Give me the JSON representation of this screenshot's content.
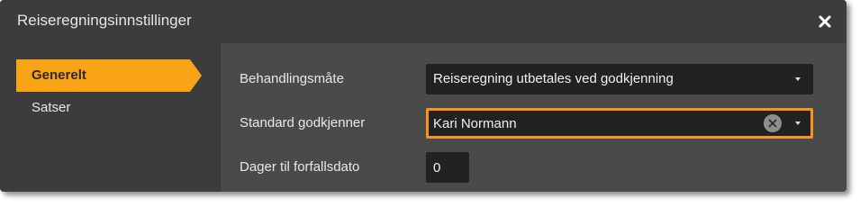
{
  "dialog": {
    "title": "Reiseregningsinnstillinger",
    "close_icon": "close-icon"
  },
  "sidebar": {
    "items": [
      {
        "label": "Generelt",
        "active": true
      },
      {
        "label": "Satser",
        "active": false
      }
    ]
  },
  "form": {
    "behandlingsmate": {
      "label": "Behandlingsmåte",
      "value": "Reiseregning utbetales ved godkjenning"
    },
    "standard_godkjenner": {
      "label": "Standard godkjenner",
      "value": "Kari Normann",
      "clear_icon": "clear-icon"
    },
    "dager_til_forfallsdato": {
      "label": "Dager til forfallsdato",
      "value": "0"
    }
  },
  "colors": {
    "accent": "#f9a316",
    "focus_border": "#f7941d",
    "background": "#3c3c3c",
    "panel": "#4a4a4a",
    "input": "#222222"
  }
}
